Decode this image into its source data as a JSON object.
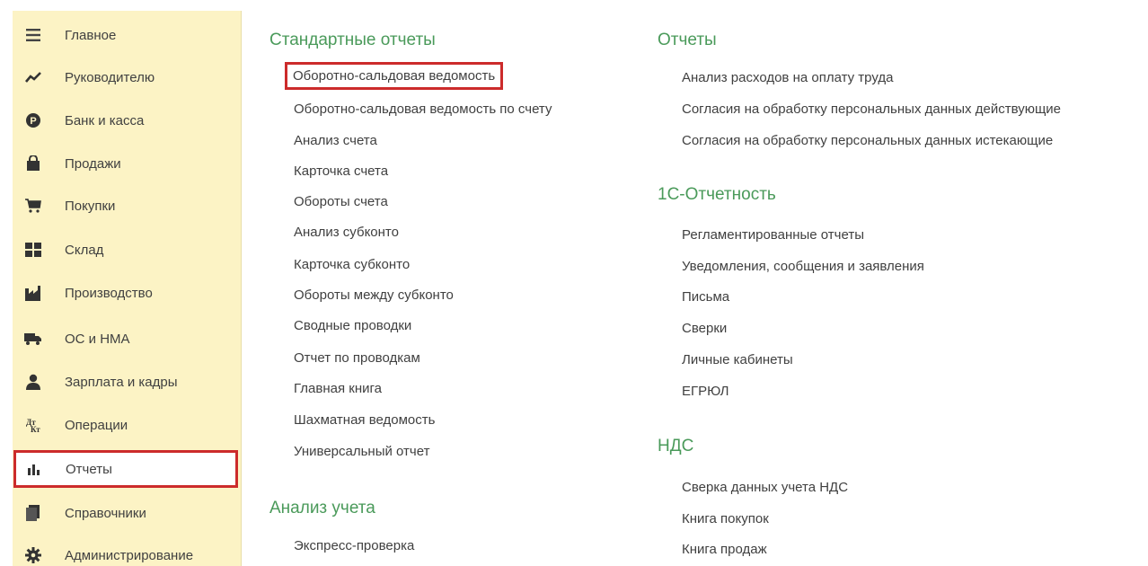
{
  "sidebar": {
    "items": [
      {
        "label": "Главное",
        "icon": "menu-icon"
      },
      {
        "label": "Руководителю",
        "icon": "trend-icon"
      },
      {
        "label": "Банк и касса",
        "icon": "coin-icon"
      },
      {
        "label": "Продажи",
        "icon": "shopping-bag-icon"
      },
      {
        "label": "Покупки",
        "icon": "cart-icon"
      },
      {
        "label": "Склад",
        "icon": "warehouse-icon"
      },
      {
        "label": "Производство",
        "icon": "factory-icon"
      },
      {
        "label": "ОС и НМА",
        "icon": "truck-icon"
      },
      {
        "label": "Зарплата и кадры",
        "icon": "person-icon"
      },
      {
        "label": "Операции",
        "icon": "operations-icon"
      },
      {
        "label": "Отчеты",
        "icon": "bar-chart-icon",
        "selected": true
      },
      {
        "label": "Справочники",
        "icon": "book-icon"
      },
      {
        "label": "Администрирование",
        "icon": "gear-icon"
      }
    ]
  },
  "standard_reports": {
    "title": "Стандартные отчеты",
    "items": [
      "Оборотно-сальдовая ведомость",
      "Оборотно-сальдовая ведомость по счету",
      "Анализ счета",
      "Карточка счета",
      "Обороты счета",
      "Анализ субконто",
      "Карточка субконто",
      "Обороты между субконто",
      "Сводные проводки",
      "Отчет по проводкам",
      "Главная книга",
      "Шахматная ведомость",
      "Универсальный отчет"
    ]
  },
  "accounting_analysis": {
    "title": "Анализ учета",
    "items": [
      "Экспресс-проверка"
    ]
  },
  "reports": {
    "title": "Отчеты",
    "items": [
      "Анализ расходов на оплату труда",
      "Согласия на обработку персональных данных действующие",
      "Согласия на обработку персональных данных истекающие"
    ]
  },
  "reporting_1c": {
    "title": "1С-Отчетность",
    "items": [
      "Регламентированные отчеты",
      "Уведомления, сообщения и заявления",
      "Письма",
      "Сверки",
      "Личные кабинеты",
      "ЕГРЮЛ"
    ]
  },
  "vat": {
    "title": "НДС",
    "items": [
      "Сверка данных учета НДС",
      "Книга покупок",
      "Книга продаж"
    ]
  },
  "colors": {
    "sidebar_bg": "#fcf3c5",
    "section_title": "#4a9a5a",
    "highlight_border": "#cc2b2b",
    "text": "#404040"
  }
}
